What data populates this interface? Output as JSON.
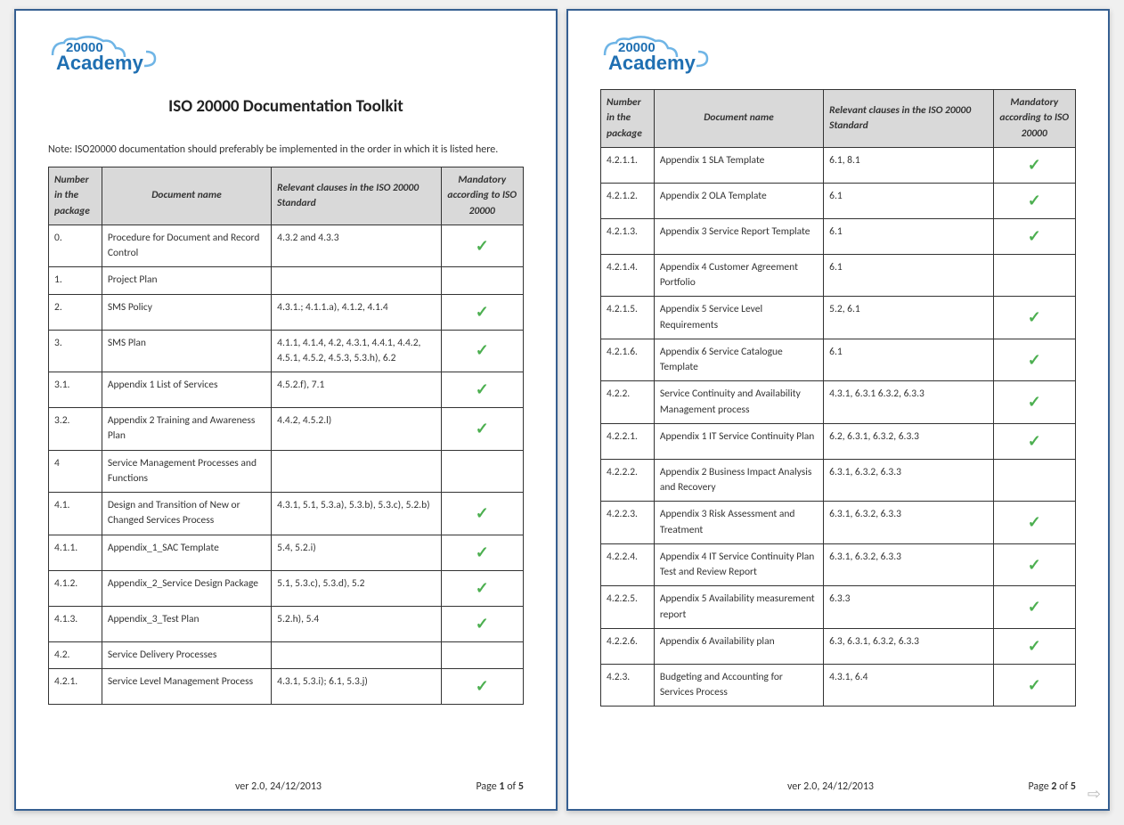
{
  "brand": {
    "top": "20000",
    "bottom": "Academy"
  },
  "title": "ISO 20000 Documentation Toolkit",
  "note": "Note: ISO20000 documentation should preferably be implemented in the order in which it is listed here.",
  "headers": {
    "num": "Number in the package",
    "name": "Document name",
    "clauses": "Relevant clauses in the ISO 20000 Standard",
    "mandatory": "Mandatory according to ISO 20000"
  },
  "footer": {
    "version": "ver  2.0, 24/12/2013",
    "page_prefix": "Page ",
    "page_mid": " of ",
    "total": "5"
  },
  "page1": {
    "page_num": "1",
    "rows": [
      {
        "num": "0.",
        "name": "Procedure for Document and Record Control",
        "clauses": "4.3.2 and 4.3.3",
        "mandatory": true
      },
      {
        "num": "1.",
        "name": "Project Plan",
        "clauses": "",
        "mandatory": false
      },
      {
        "num": "2.",
        "name": "SMS Policy",
        "clauses": "4.3.1.; 4.1.1.a), 4.1.2, 4.1.4",
        "mandatory": true
      },
      {
        "num": "3.",
        "name": "SMS Plan",
        "clauses": "4.1.1, 4.1.4, 4.2, 4.3.1, 4.4.1, 4.4.2, 4.5.1, 4.5.2, 4.5.3, 5.3.h), 6.2",
        "mandatory": true
      },
      {
        "num": "3.1.",
        "name": "Appendix 1 List of Services",
        "clauses": "4.5.2.f), 7.1",
        "mandatory": true
      },
      {
        "num": "3.2.",
        "name": "Appendix 2 Training and Awareness Plan",
        "clauses": "4.4.2, 4.5.2.l)",
        "mandatory": true
      },
      {
        "num": "4",
        "name": "Service Management Processes and Functions",
        "clauses": "",
        "mandatory": false
      },
      {
        "num": "4.1.",
        "name": "Design and Transition of New or Changed Services Process",
        "clauses": "4.3.1, 5.1, 5.3.a), 5.3.b), 5.3.c), 5.2.b)",
        "mandatory": true
      },
      {
        "num": "4.1.1.",
        "name": "Appendix_1_SAC Template",
        "clauses": "5.4, 5.2.i)",
        "mandatory": true
      },
      {
        "num": "4.1.2.",
        "name": "Appendix_2_Service Design Package",
        "clauses": "5.1, 5.3.c), 5.3.d), 5.2",
        "mandatory": true
      },
      {
        "num": "4.1.3.",
        "name": "Appendix_3_Test Plan",
        "clauses": "5.2.h), 5.4",
        "mandatory": true
      },
      {
        "num": "4.2.",
        "name": "Service Delivery Processes",
        "clauses": "",
        "mandatory": false
      },
      {
        "num": "4.2.1.",
        "name": "Service Level Management Process",
        "clauses": "4.3.1, 5.3.i); 6.1, 5.3.j)",
        "mandatory": true
      }
    ]
  },
  "page2": {
    "page_num": "2",
    "rows": [
      {
        "num": "4.2.1.1.",
        "name": "Appendix 1 SLA Template",
        "clauses": "6.1, 8.1",
        "mandatory": true
      },
      {
        "num": "4.2.1.2.",
        "name": "Appendix 2 OLA Template",
        "clauses": "6.1",
        "mandatory": true
      },
      {
        "num": "4.2.1.3.",
        "name": "Appendix 3 Service Report Template",
        "clauses": "6.1",
        "mandatory": true
      },
      {
        "num": "4.2.1.4.",
        "name": "Appendix 4 Customer Agreement Portfolio",
        "clauses": "6.1",
        "mandatory": false
      },
      {
        "num": "4.2.1.5.",
        "name": "Appendix 5 Service Level Requirements",
        "clauses": "5.2, 6.1",
        "mandatory": true
      },
      {
        "num": "4.2.1.6.",
        "name": "Appendix 6 Service Catalogue Template",
        "clauses": "6.1",
        "mandatory": true
      },
      {
        "num": "4.2.2.",
        "name": "Service Continuity and Availability Management process",
        "clauses": "4.3.1, 6.3.1 6.3.2, 6.3.3",
        "mandatory": true
      },
      {
        "num": "4.2.2.1.",
        "name": "Appendix 1 IT Service Continuity Plan",
        "clauses": "6.2, 6.3.1, 6.3.2, 6.3.3",
        "mandatory": true
      },
      {
        "num": "4.2.2.2.",
        "name": "Appendix 2 Business Impact Analysis and Recovery",
        "clauses": "6.3.1, 6.3.2, 6.3.3",
        "mandatory": false
      },
      {
        "num": "4.2.2.3.",
        "name": "Appendix 3 Risk Assessment and Treatment",
        "clauses": "6.3.1, 6.3.2, 6.3.3",
        "mandatory": true
      },
      {
        "num": "4.2.2.4.",
        "name": "Appendix 4 IT Service Continuity Plan Test and Review Report",
        "clauses": "6.3.1, 6.3.2, 6.3.3",
        "mandatory": true
      },
      {
        "num": "4.2.2.5.",
        "name": "Appendix 5 Availability measurement report",
        "clauses": "6.3.3",
        "mandatory": true
      },
      {
        "num": "4.2.2.6.",
        "name": "Appendix 6 Availability plan",
        "clauses": "6.3, 6.3.1, 6.3.2, 6.3.3",
        "mandatory": true
      },
      {
        "num": "4.2.3.",
        "name": "Budgeting and Accounting for Services  Process",
        "clauses": "4.3.1, 6.4",
        "mandatory": true
      }
    ]
  }
}
